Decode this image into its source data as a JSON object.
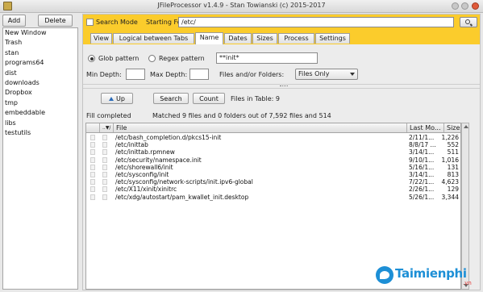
{
  "window": {
    "title": "JFileProcessor v1.4.9 - Stan Towianski (c) 2015-2017"
  },
  "left": {
    "add_label": "Add",
    "delete_label": "Delete",
    "items": [
      "New Window",
      "Trash",
      "stan",
      "programs64",
      "dist",
      "downloads",
      "Dropbox",
      "tmp",
      "embeddable",
      "libs",
      "testutils"
    ]
  },
  "search": {
    "search_mode_label": "Search Mode",
    "search_mode_checked": false,
    "starting_folder_label": "Starting Folder",
    "starting_folder_value": "/etc/"
  },
  "tabs": [
    {
      "label": "View",
      "active": false
    },
    {
      "label": "Logical between Tabs",
      "active": false
    },
    {
      "label": "Name",
      "active": true
    },
    {
      "label": "Dates",
      "active": false
    },
    {
      "label": "Sizes",
      "active": false
    },
    {
      "label": "Process",
      "active": false
    },
    {
      "label": "Settings",
      "active": false
    }
  ],
  "name_tab": {
    "glob_label": "Glob pattern",
    "regex_label": "Regex pattern",
    "selected_pattern": "Glob pattern",
    "pattern_value": "**init*",
    "min_depth_label": "Min Depth:",
    "min_depth_value": "",
    "max_depth_label": "Max Depth:",
    "max_depth_value": "",
    "files_folders_label": "Files and/or Folders:",
    "files_folders_value": "Files Only"
  },
  "toolbar": {
    "up_label": "Up",
    "search_label": "Search",
    "count_label": "Count",
    "files_in_table_label": "Files in Table:",
    "files_in_table_count": "9"
  },
  "status": {
    "state": "Fill completed",
    "message": "Matched 9 files and 0 folders out of 7,592 files and 514"
  },
  "table": {
    "sort_indicator": "..▼/",
    "columns": [
      "File",
      "Last Mo...",
      "Size"
    ],
    "rows": [
      {
        "file": "/etc/bash_completion.d/pkcs15-init",
        "modified": "2/11/1...",
        "size": "1,226"
      },
      {
        "file": "/etc/inittab",
        "modified": "8/8/17 ...",
        "size": "552"
      },
      {
        "file": "/etc/inittab.rpmnew",
        "modified": "3/14/1...",
        "size": "511"
      },
      {
        "file": "/etc/security/namespace.init",
        "modified": "9/10/1...",
        "size": "1,016"
      },
      {
        "file": "/etc/shorewall6/init",
        "modified": "5/16/1...",
        "size": "131"
      },
      {
        "file": "/etc/sysconfig/init",
        "modified": "3/14/1...",
        "size": "813"
      },
      {
        "file": "/etc/sysconfig/network-scripts/init.ipv6-global",
        "modified": "7/22/1...",
        "size": "4,623"
      },
      {
        "file": "/etc/X11/xinit/xinitrc",
        "modified": "2/26/1...",
        "size": "129"
      },
      {
        "file": "/etc/xdg/autostart/pam_kwallet_init.desktop",
        "modified": "5/26/1...",
        "size": "3,344"
      }
    ]
  },
  "watermark": {
    "text": "Taimienphi",
    "suffix": ".vn"
  },
  "colors": {
    "accent_bar": "#fbcc2c",
    "watermark_blue": "#1d8fd6",
    "close_red": "#e05a3a"
  }
}
